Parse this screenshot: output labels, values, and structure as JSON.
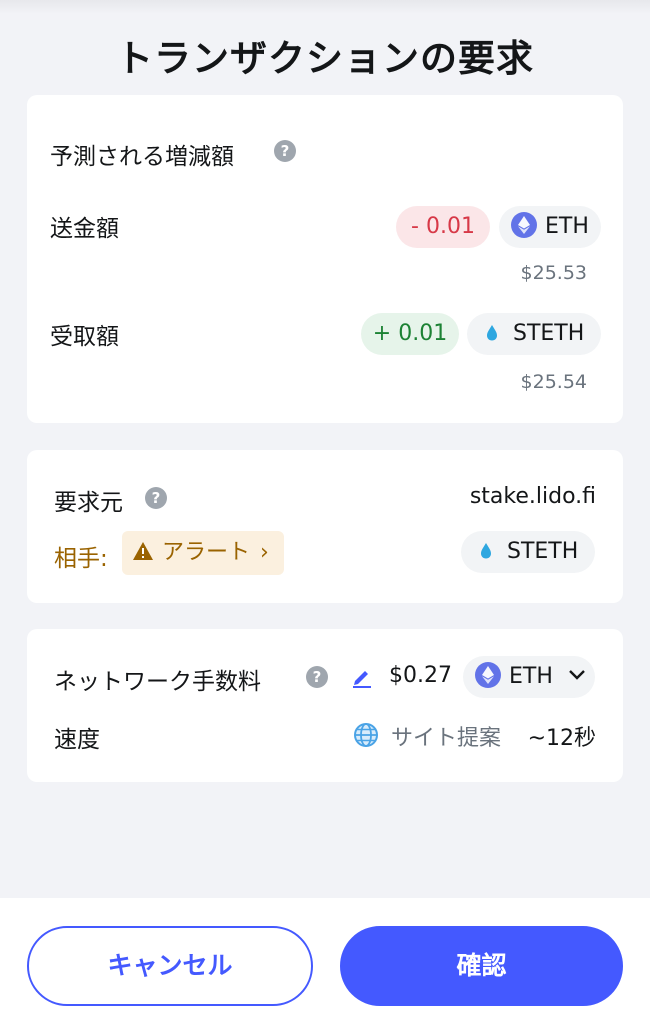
{
  "header": {
    "title": "トランザクションの要求"
  },
  "estimated_changes": {
    "title": "予測される増減額",
    "send": {
      "label": "送金額",
      "amount": "- 0.01",
      "token": "ETH",
      "usd": "$25.53"
    },
    "receive": {
      "label": "受取額",
      "amount": "+ 0.01",
      "token": "STETH",
      "usd": "$25.54"
    }
  },
  "request": {
    "label": "要求元",
    "origin": "stake.lido.fi",
    "counterparty_label": "相手:",
    "alert_label": "アラート",
    "token": "STETH"
  },
  "network_fee": {
    "label": "ネットワーク手数料",
    "amount": "$0.27",
    "token": "ETH",
    "speed_label": "速度",
    "speed_value": "サイト提案",
    "speed_time": "~12秒"
  },
  "footer": {
    "cancel_label": "キャンセル",
    "confirm_label": "確認"
  },
  "colors": {
    "accent": "#4459ff",
    "negative": "#d73847",
    "positive": "#1c8234",
    "warning": "#9a6300"
  }
}
